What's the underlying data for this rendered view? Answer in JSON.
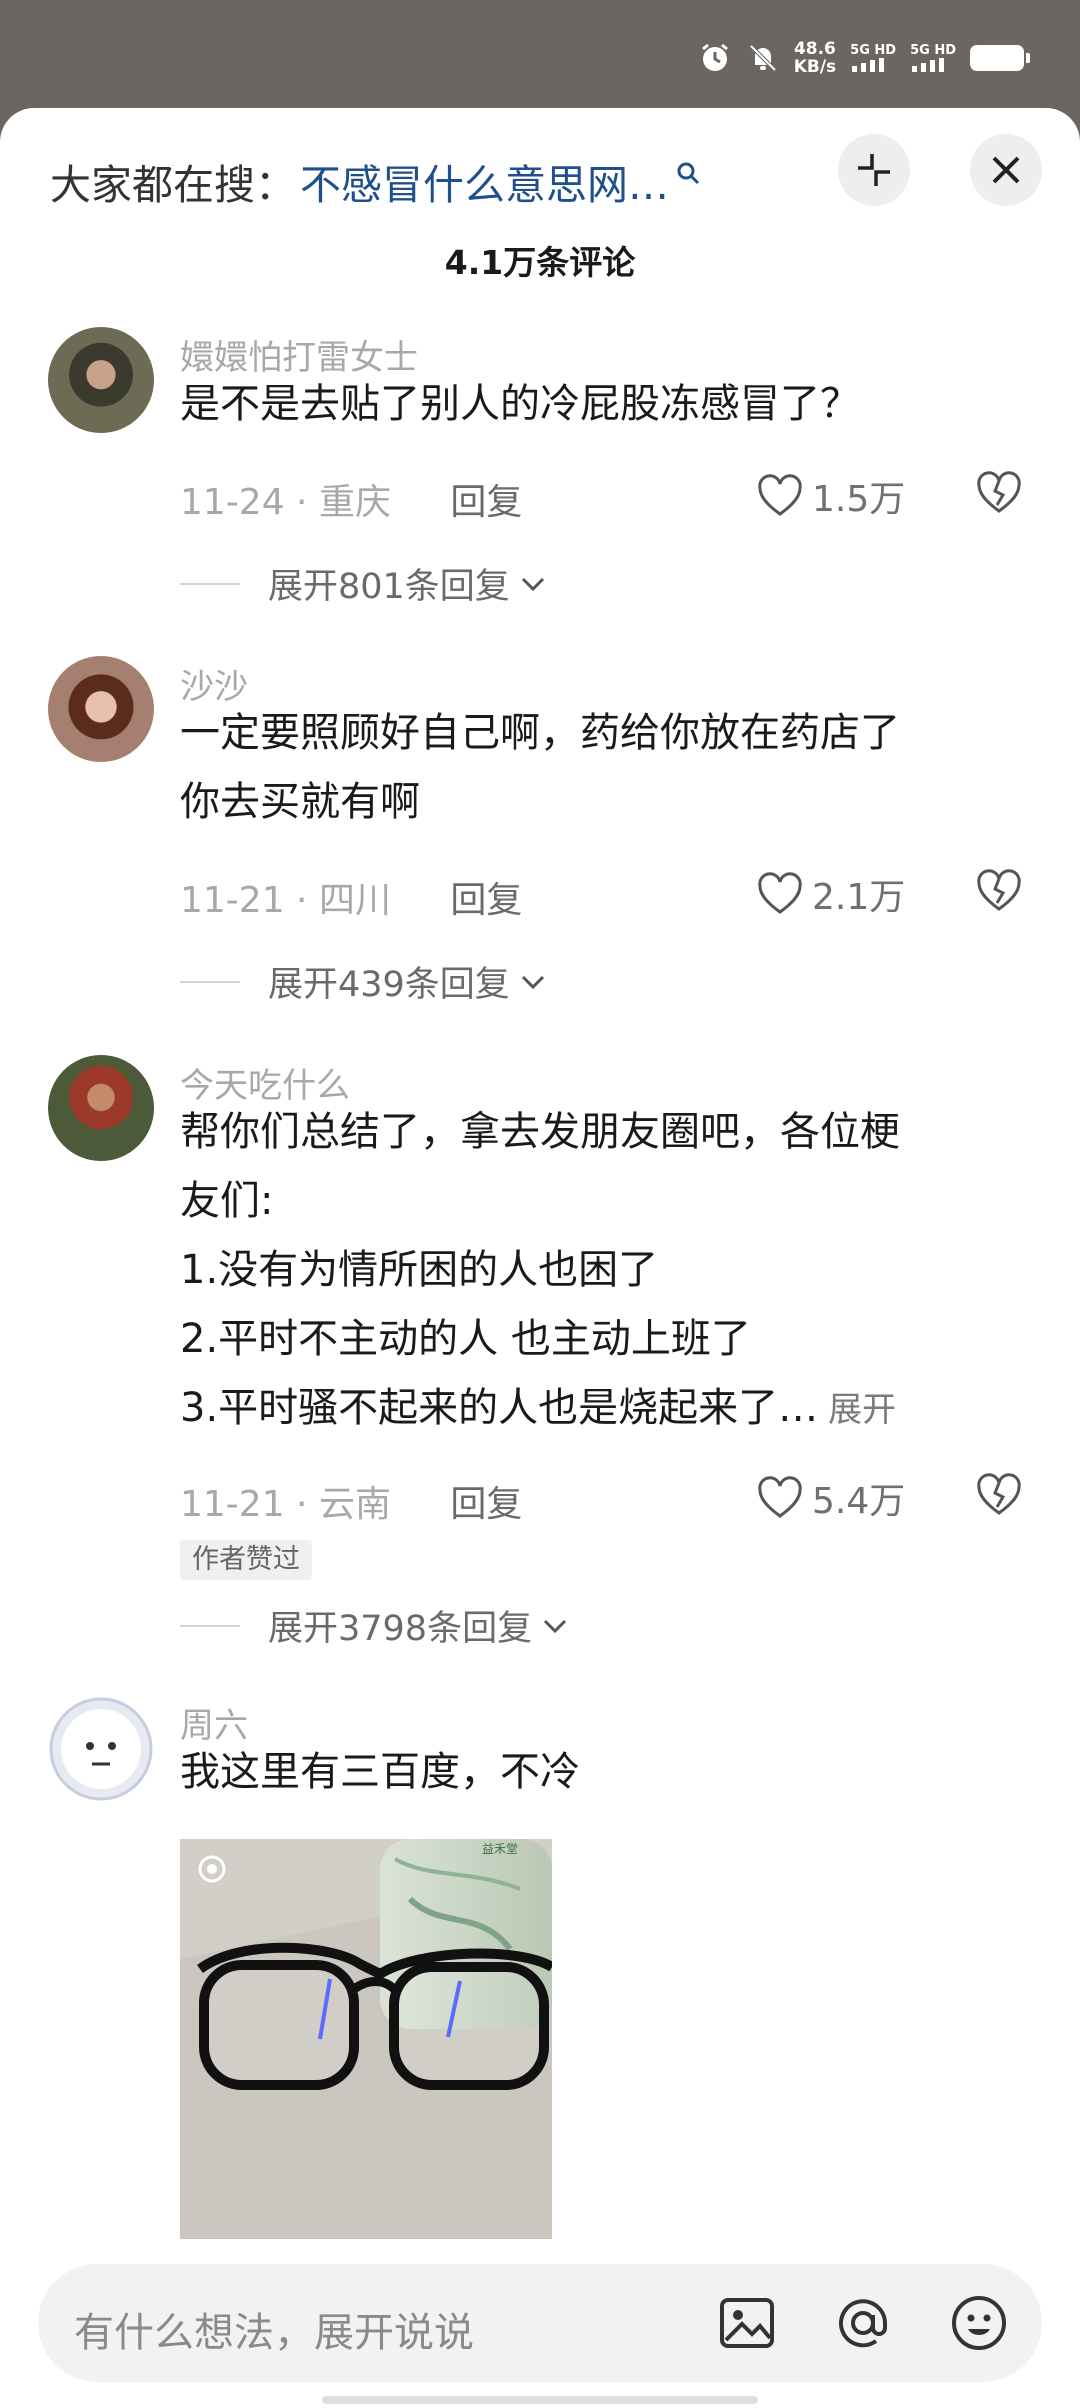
{
  "status": {
    "left_text": "",
    "speed_value": "48.6",
    "speed_unit": "KB/s",
    "net1": "5G HD",
    "net2": "5G HD"
  },
  "search": {
    "prefix": "大家都在搜：",
    "query": "不感冒什么意思网…"
  },
  "comments_header": {
    "count_label": "4.1万条评论"
  },
  "comments": [
    {
      "username": "嬛嬛怕打雷女士",
      "lines": [
        "是不是去贴了别人的冷屁股冻感冒了？"
      ],
      "date": "11-24",
      "location": "重庆",
      "reply_label": "回复",
      "likes": "1.5万",
      "expand_label": "展开801条回复"
    },
    {
      "username": "沙沙",
      "lines": [
        "一定要照顾好自己啊，药给你放在药店了",
        "你去买就有啊"
      ],
      "date": "11-21",
      "location": "四川",
      "reply_label": "回复",
      "likes": "2.1万",
      "expand_label": "展开439条回复"
    },
    {
      "username": "今天吃什么",
      "lines": [
        "帮你们总结了，拿去发朋友圈吧，各位梗",
        "友们:",
        "1.没有为情所困的人也困了",
        "2.平时不主动的人 也主动上班了",
        "3.平时骚不起来的人也是烧起来了…"
      ],
      "inline_expand": "展开",
      "date": "11-21",
      "location": "云南",
      "reply_label": "回复",
      "likes": "5.4万",
      "badge": "作者赞过",
      "expand_label": "展开3798条回复"
    },
    {
      "username": "周六",
      "lines": [
        "我这里有三百度，不冷"
      ]
    }
  ],
  "photo": {
    "bottle_text": "益禾堂"
  },
  "bottom_bar": {
    "placeholder": "有什么想法，展开说说"
  },
  "colors": {
    "link": "#1f4f8c",
    "meta": "#a8a8a8",
    "sheet": "#ffffff"
  }
}
